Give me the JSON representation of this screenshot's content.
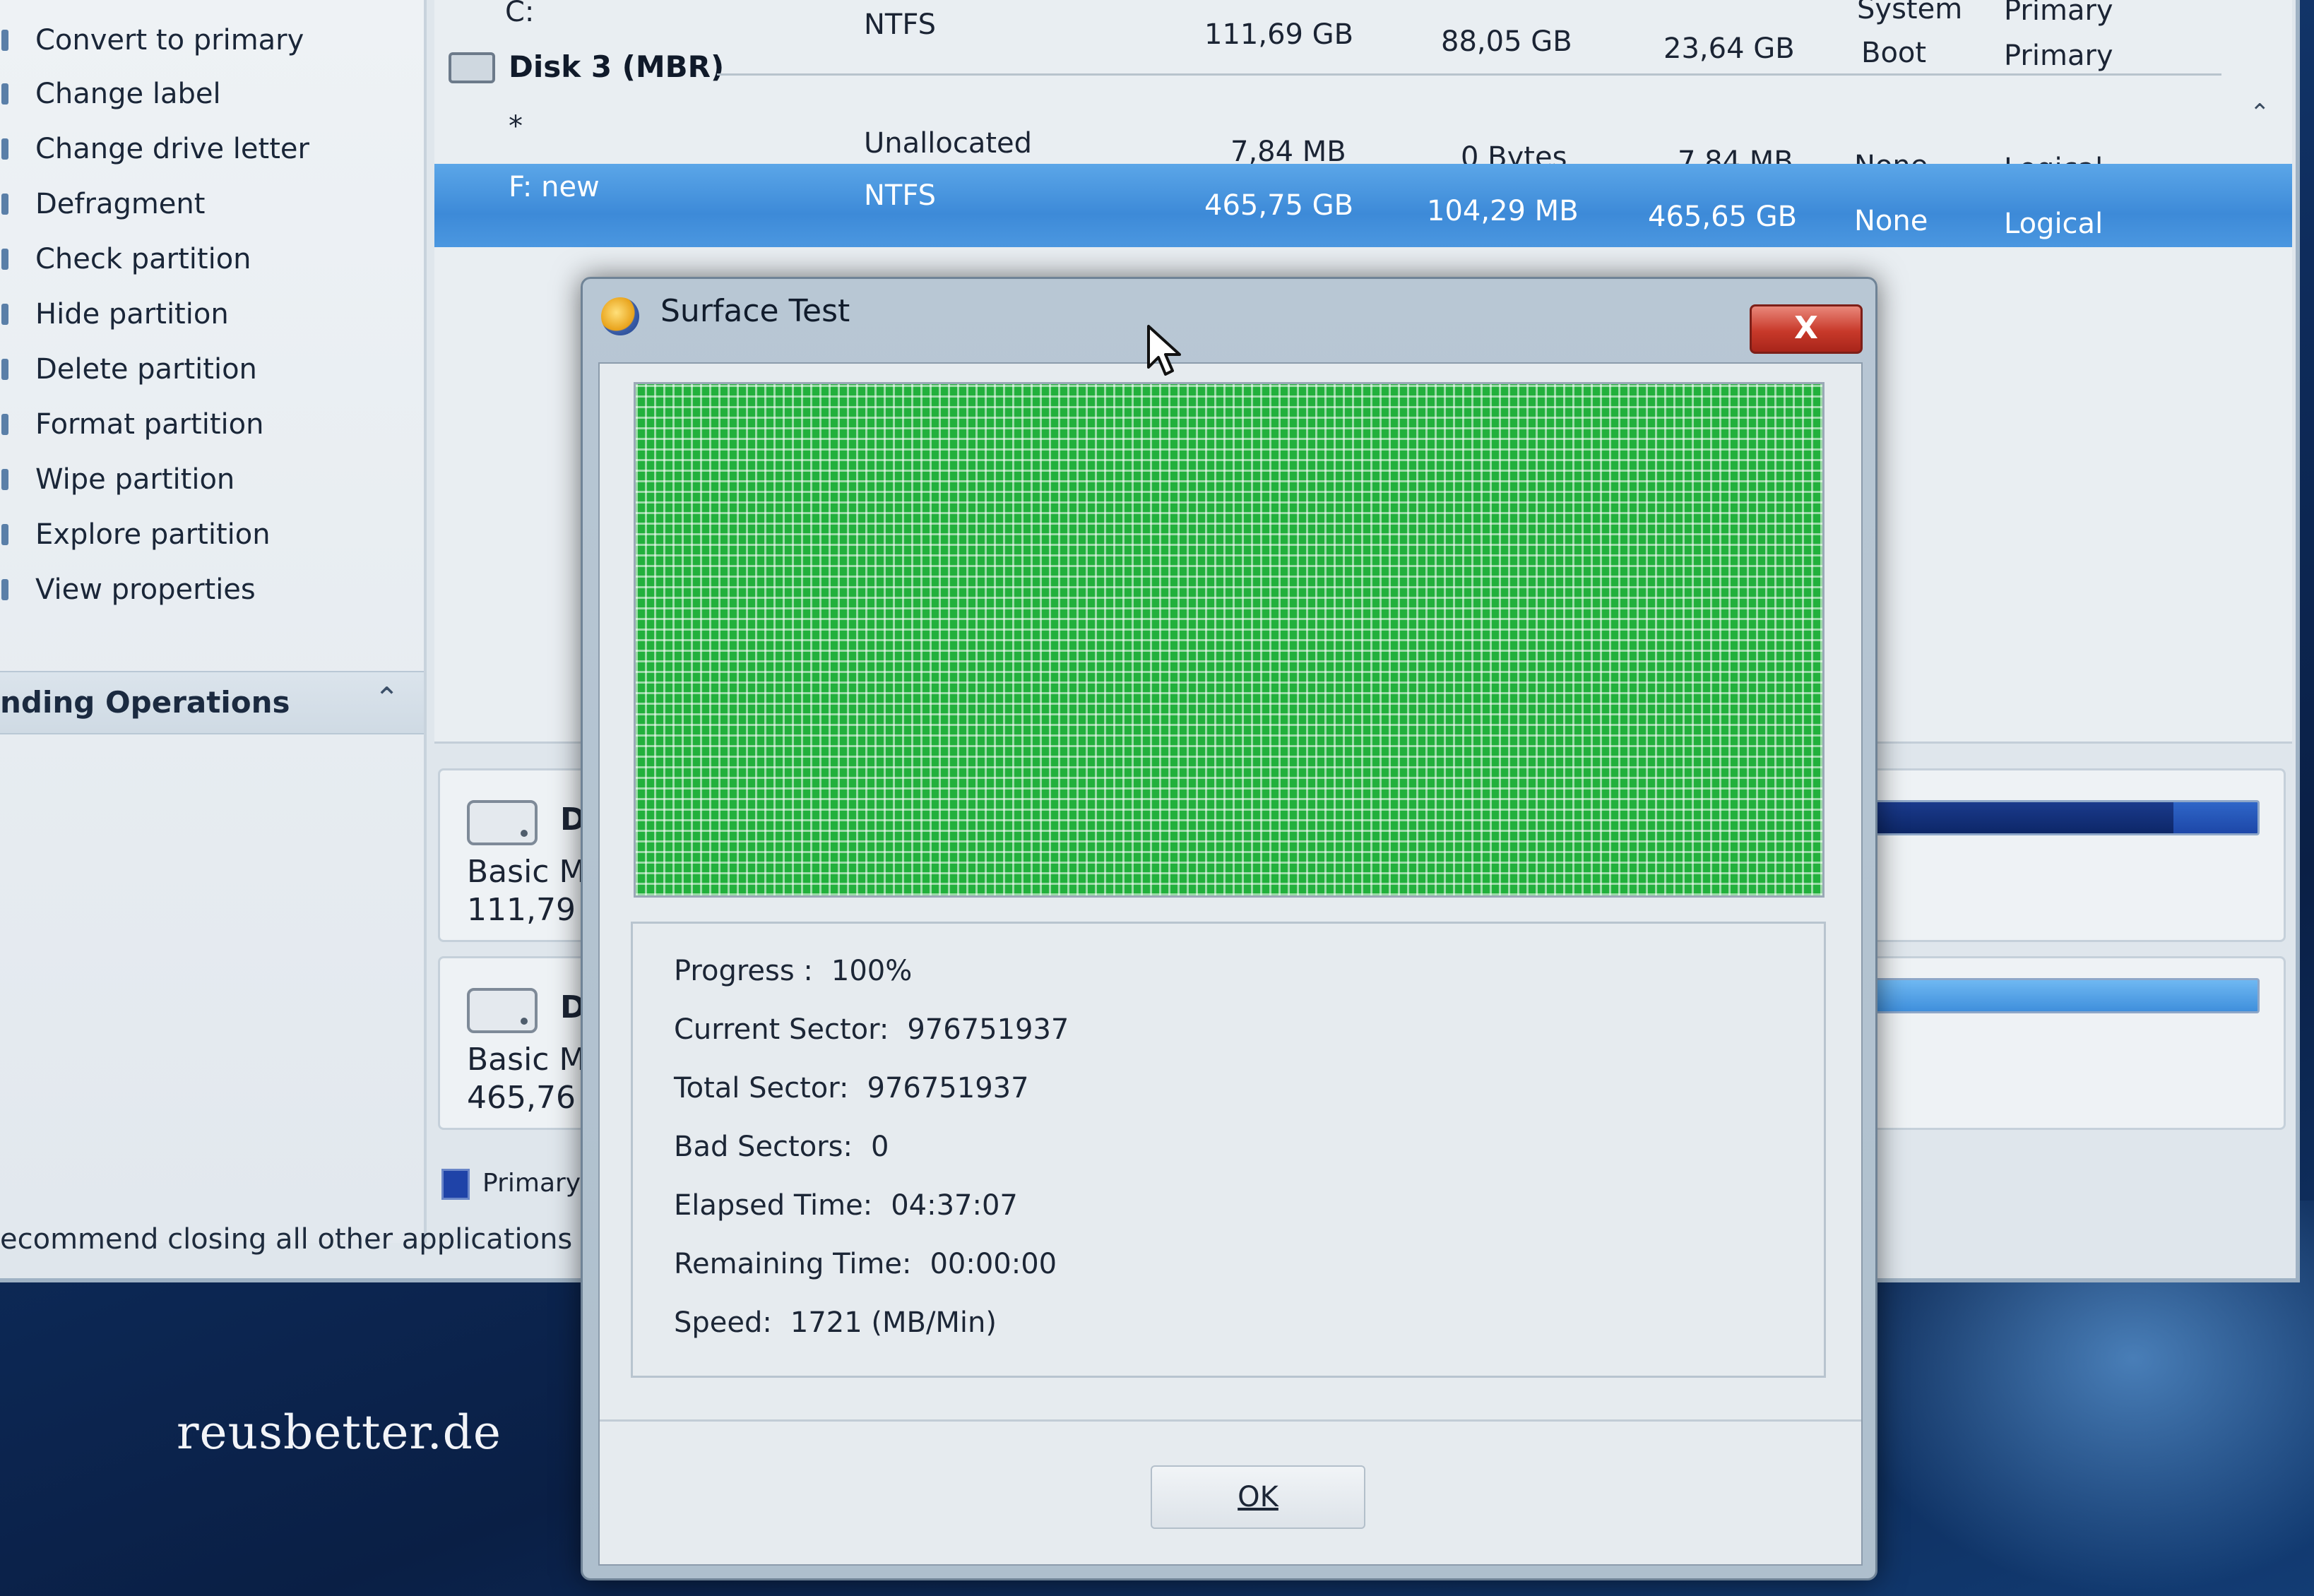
{
  "sidebar": {
    "items": [
      {
        "label": "Convert to primary"
      },
      {
        "label": "Change label"
      },
      {
        "label": "Change drive letter"
      },
      {
        "label": "Defragment"
      },
      {
        "label": "Check partition"
      },
      {
        "label": "Hide partition"
      },
      {
        "label": "Delete partition"
      },
      {
        "label": "Format partition"
      },
      {
        "label": "Wipe partition"
      },
      {
        "label": "Explore partition"
      },
      {
        "label": "View properties"
      }
    ],
    "pending_header": "nding Operations",
    "status_text": "ecommend closing all other applications whil"
  },
  "partition_list": {
    "rows_top": [
      {
        "partition": "C:",
        "fs": "NTFS",
        "capacity": "111,69 GB",
        "used": "88,05 GB",
        "unused": "23,64 GB",
        "flag": "Boot",
        "type": "Primary"
      }
    ],
    "top_partial": {
      "flag": "System",
      "type": "Primary"
    },
    "disk_label": "Disk 3 (MBR)",
    "rows": [
      {
        "partition": "*",
        "fs": "Unallocated",
        "capacity": "7,84 MB",
        "used": "0 Bytes",
        "unused": "7,84 MB",
        "flag": "None",
        "type": "Logical"
      },
      {
        "partition": "F: new",
        "fs": "NTFS",
        "capacity": "465,75 GB",
        "used": "104,29 MB",
        "unused": "465,65 GB",
        "flag": "None",
        "type": "Logical",
        "selected": true
      }
    ]
  },
  "disk_map": [
    {
      "name": "D",
      "type": "Basic MB",
      "size": "111,79",
      "used_fraction": 0.78
    },
    {
      "name": "D",
      "type": "Basic MB",
      "size": "465,76",
      "used_fraction": 0.0
    }
  ],
  "legend": {
    "primary": "Primary"
  },
  "dialog": {
    "title": "Surface Test",
    "close_label": "X",
    "info": {
      "progress": {
        "label": "Progress :",
        "value": "100%"
      },
      "current_sector": {
        "label": "Current Sector:",
        "value": "976751937"
      },
      "total_sector": {
        "label": "Total Sector:",
        "value": "976751937"
      },
      "bad_sectors": {
        "label": "Bad Sectors:",
        "value": "0"
      },
      "elapsed_time": {
        "label": "Elapsed Time:",
        "value": "04:37:07"
      },
      "remaining_time": {
        "label": "Remaining Time:",
        "value": "00:00:00"
      },
      "speed": {
        "label": "Speed:",
        "value": "1721 (MB/Min)"
      }
    },
    "ok_label": "OK"
  },
  "watermark": "reusbetter.de",
  "colors": {
    "good_block": "#22b03c",
    "selection": "#3d8ad8",
    "close_button": "#c8392a"
  }
}
